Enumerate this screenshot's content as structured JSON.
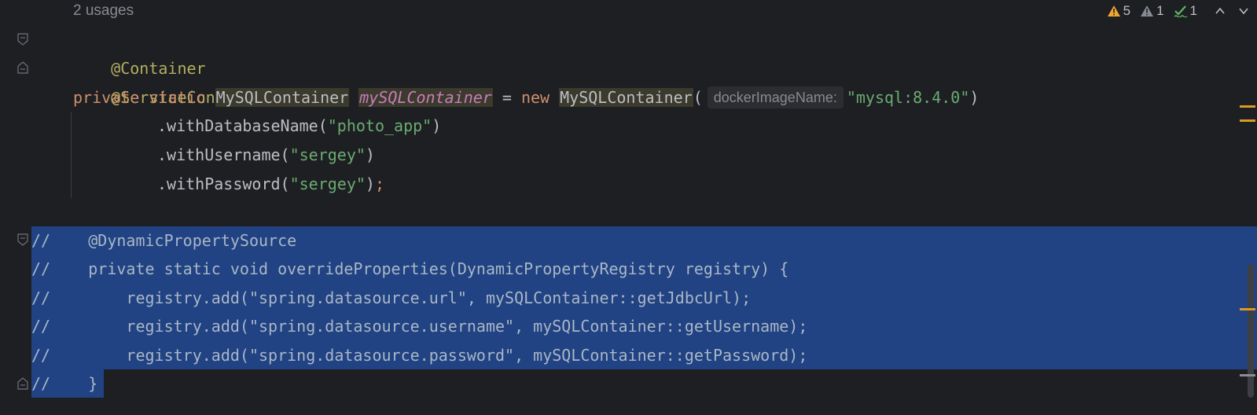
{
  "header": {
    "usages": "2 usages"
  },
  "inspections": {
    "warnings": "5",
    "weak_warnings": "1",
    "typos": "1"
  },
  "code": {
    "ann1": "@Container",
    "ann2": "@ServiceConnection",
    "decl": {
      "private": "private",
      "static": "static",
      "type": "MySQLContainer",
      "field": "mySQLContainer",
      "eq": " = ",
      "new": "new",
      "ctor": "MySQLContainer",
      "paren_open": "(",
      "hint": "dockerImageName:",
      "arg": "\"mysql:8.4.0\"",
      "paren_close": ")"
    },
    "chain1": {
      "call": ".withDatabaseName(",
      "arg": "\"photo_app\"",
      "close": ")"
    },
    "chain2": {
      "call": ".withUsername(",
      "arg": "\"sergey\"",
      "close": ")"
    },
    "chain3": {
      "call": ".withPassword(",
      "arg": "\"sergey\"",
      "close": ")",
      "semi": ";"
    }
  },
  "commented": {
    "l1": "//    @DynamicPropertySource",
    "l2": "//    private static void overrideProperties(DynamicPropertyRegistry registry) {",
    "l3": "//        registry.add(\"spring.datasource.url\", mySQLContainer::getJdbcUrl);",
    "l4": "//        registry.add(\"spring.datasource.username\", mySQLContainer::getUsername);",
    "l5": "//        registry.add(\"spring.datasource.password\", mySQLContainer::getPassword);",
    "l6": "//    }"
  },
  "colors": {
    "background": "#1e1f22",
    "selection": "#214283",
    "annotation": "#b3ae60",
    "keyword": "#cf8e6d",
    "string": "#6aab73",
    "field": "#c77dbb",
    "warning": "#f0a732"
  }
}
